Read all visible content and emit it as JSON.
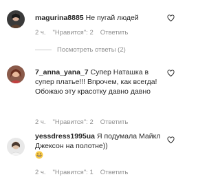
{
  "comments": [
    {
      "username": "magurina8885",
      "text": "Не пугай людей",
      "time": "2 ч.",
      "likes": "\"Нравится\": 2",
      "reply": "Ответить",
      "replies": "Посмотреть ответы (2)",
      "avatar_icon": "avatar-photo-icon",
      "like_icon": "heart-outline-icon"
    },
    {
      "username": "7_anna_yana_7",
      "text": "Супер Наташка в супер платье!!! Впрочем, как всегда! Обожаю эту красотку давно давно",
      "time": "2 ч.",
      "likes": "\"Нравится\": 2",
      "reply": "Ответить",
      "avatar_icon": "avatar-photo-icon",
      "like_icon": "heart-outline-icon"
    },
    {
      "username": "yessdress1995ua",
      "text": "Я подумала Майкл Джексон на полотне))",
      "emoji": "grinning-face-emoji",
      "time": "2 ч.",
      "likes": "\"Нравится\": 1",
      "reply": "Ответить",
      "avatar_icon": "avatar-photo-icon",
      "like_icon": "heart-outline-icon"
    }
  ],
  "colors": {
    "text": "#262626",
    "secondary": "#8e8e8e",
    "divider": "#c7c7c7",
    "background": "#ffffff"
  }
}
